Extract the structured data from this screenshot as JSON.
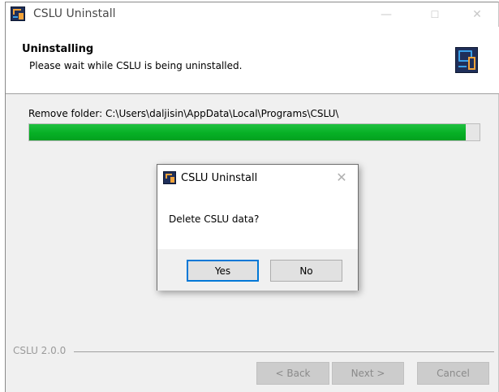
{
  "window": {
    "title": "CSLU Uninstall",
    "controls": {
      "minimize": "—",
      "maximize": "☐",
      "close": "✕"
    }
  },
  "header": {
    "title": "Uninstalling",
    "subtitle": "Please wait while CSLU is being uninstalled."
  },
  "status": {
    "text": "Remove folder: C:\\Users\\daljisin\\AppData\\Local\\Programs\\CSLU\\",
    "progress_fraction": 0.97
  },
  "footer": {
    "version_label": "CSLU 2.0.0",
    "back_label": "< Back",
    "next_label": "Next >",
    "cancel_label": "Cancel"
  },
  "dialog": {
    "title": "CSLU Uninstall",
    "close_glyph": "✕",
    "message": "Delete CSLU data?",
    "yes_label": "Yes",
    "no_label": "No"
  },
  "colors": {
    "progress_green": "#06b025",
    "default_button_border": "#0078d7",
    "brand_dark": "#1f2f5a",
    "brand_orange": "#f2a33a",
    "brand_blue": "#3aa0e8"
  },
  "icons": {
    "app": "cslu-app-icon",
    "header": "cslu-devices-icon"
  }
}
